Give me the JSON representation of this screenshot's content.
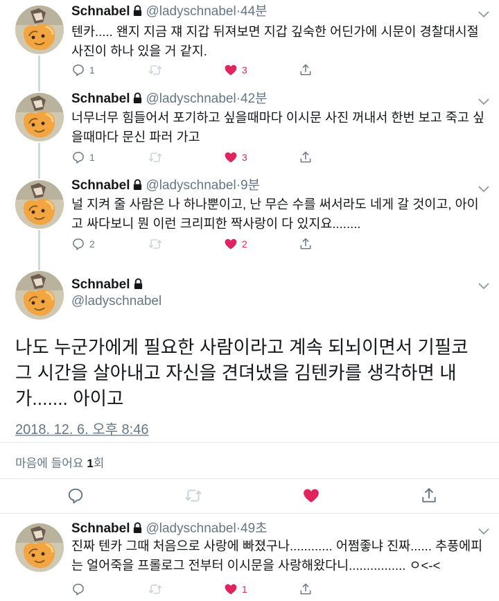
{
  "colors": {
    "like": "#e0245e",
    "muted": "#657786",
    "text": "#14171a",
    "retweet_disabled": "#ccd6dd",
    "divider": "#e6ecf0"
  },
  "tweets": [
    {
      "name": "Schnabel",
      "handle": "@ladyschnabel",
      "time": "44분",
      "text": "텐카..... 왠지 지금 쟤 지갑 뒤져보면 지갑 깊숙한 어딘가에 시문이 경찰대시절 사진이 하나 있을 거 같지.",
      "reply_count": "1",
      "like_count": "3"
    },
    {
      "name": "Schnabel",
      "handle": "@ladyschnabel",
      "time": "42분",
      "text": "너무너무 힘들어서 포기하고 싶을때마다 이시문 사진 꺼내서 한번 보고 죽고 싶을때마다 문신 파러 가고",
      "reply_count": "1",
      "like_count": "3"
    },
    {
      "name": "Schnabel",
      "handle": "@ladyschnabel",
      "time": "9분",
      "text": "널 지켜 줄 사람은 나 하나뿐이고, 난 무슨 수를 써서라도 네게 갈 것이고, 아이고 싸다보니 뭔 이런 크리피한 짝사랑이 다 있지요........",
      "reply_count": "2",
      "like_count": "2"
    }
  ],
  "main_tweet": {
    "name": "Schnabel",
    "handle": "@ladyschnabel",
    "text": "나도 누군가에게 필요한 사람이라고 계속 되뇌이면서 기필코 그 시간을 살아내고 자신을 견뎌냈을 김텐카를 생각하면 내가....... 아이고",
    "date": "2018. 12. 6. 오후 8:46",
    "likes_label": "마음에 들어요",
    "likes_count": "1",
    "likes_suffix": "회"
  },
  "reply_tweet": {
    "name": "Schnabel",
    "handle": "@ladyschnabel",
    "time": "49초",
    "text": "진짜 텐카 그때 처음으로 사랑에 빠졌구나............ 어쩜좋냐 진짜...... 추풍에피는 얼어죽을 프롤로그 전부터 이시문을 사랑해왔다니................ ㅇ<-<",
    "like_count": "1"
  },
  "separator": "·",
  "icons": [
    "lock-icon",
    "chevron-down-icon",
    "reply-icon",
    "retweet-icon",
    "heart-icon",
    "share-icon",
    "avatar-image"
  ]
}
